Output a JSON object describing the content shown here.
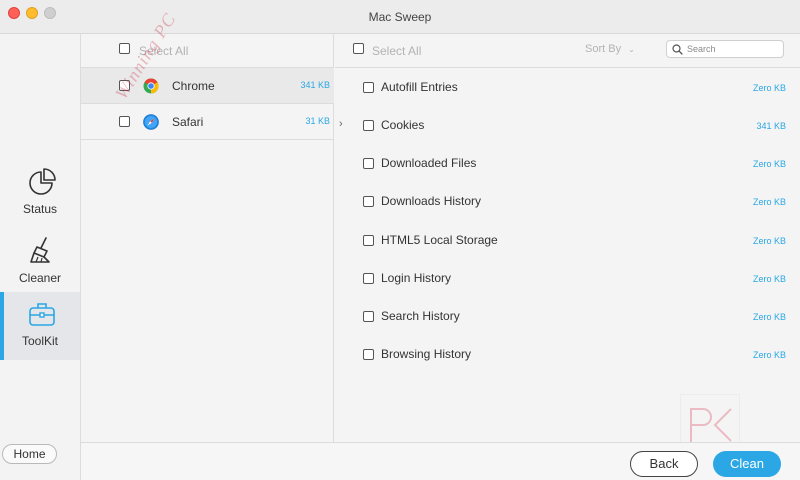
{
  "window": {
    "title": "Mac Sweep"
  },
  "sidebar": {
    "items": [
      {
        "label": "Status",
        "icon": "pie-chart-icon"
      },
      {
        "label": "Cleaner",
        "icon": "broom-icon"
      },
      {
        "label": "ToolKit",
        "icon": "toolbox-icon",
        "active": true
      }
    ],
    "home_label": "Home"
  },
  "browsers": {
    "select_all_label": "Select All",
    "rows": [
      {
        "name": "Chrome",
        "size": "341 KB",
        "icon": "chrome-icon",
        "selected": true
      },
      {
        "name": "Safari",
        "size": "31 KB",
        "icon": "safari-icon"
      }
    ]
  },
  "items": {
    "select_all_label": "Select All",
    "sort_label": "Sort By",
    "search_placeholder": "Search",
    "rows": [
      {
        "name": "Autofill Entries",
        "size": "Zero KB"
      },
      {
        "name": "Cookies",
        "size": "341 KB"
      },
      {
        "name": "Downloaded Files",
        "size": "Zero KB"
      },
      {
        "name": "Downloads History",
        "size": "Zero KB"
      },
      {
        "name": "HTML5 Local Storage",
        "size": "Zero KB"
      },
      {
        "name": "Login History",
        "size": "Zero KB"
      },
      {
        "name": "Search History",
        "size": "Zero KB"
      },
      {
        "name": "Browsing History",
        "size": "Zero KB"
      }
    ]
  },
  "footer": {
    "back_label": "Back",
    "clean_label": "Clean"
  },
  "watermark": {
    "text": "Winning PC",
    "logo_text": "PC"
  },
  "colors": {
    "accent": "#2aa7e4"
  }
}
